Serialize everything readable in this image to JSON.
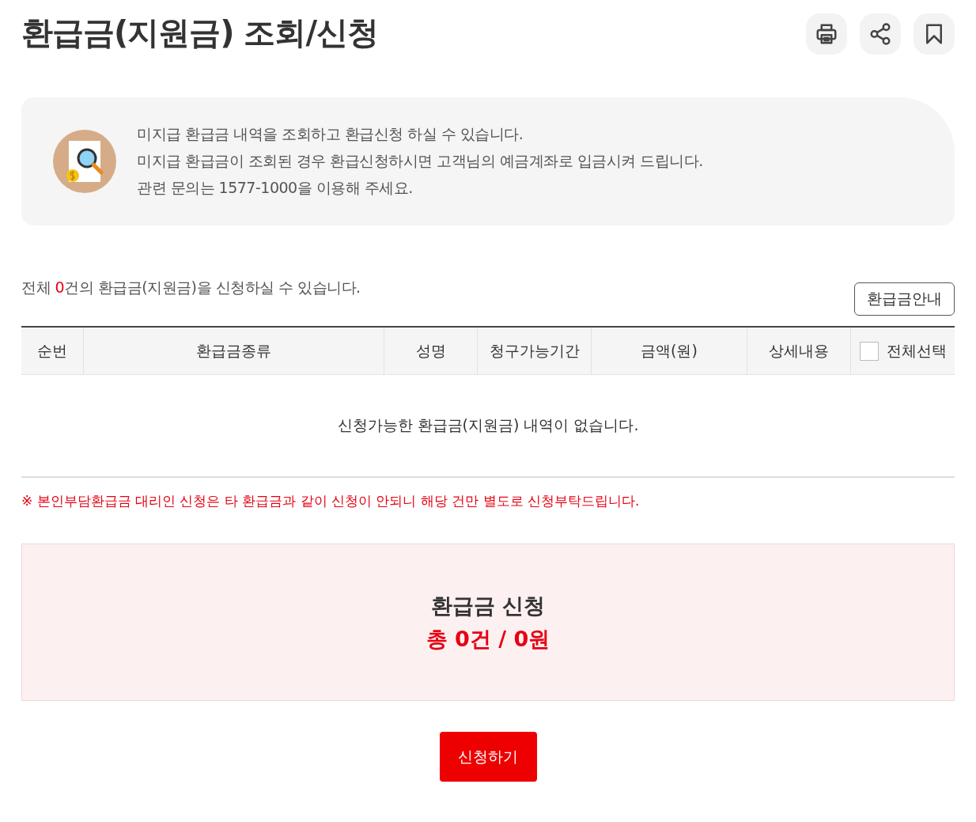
{
  "page": {
    "title": "환급금(지원금) 조회/신청"
  },
  "info": {
    "lines": [
      "미지급 환급금 내역을 조회하고 환급신청 하실 수 있습니다.",
      "미지급 환급금이 조회된 경우 환급신청하시면 고객님의 예금계좌로 입금시켜 드립니다.",
      "관련 문의는 1577-1000을 이용해 주세요."
    ]
  },
  "summary": {
    "prefix": "전체 ",
    "count": "0",
    "suffix": "건의 환급금(지원금)을 신청하실 수 있습니다.",
    "guide_button": "환급금안내"
  },
  "table": {
    "columns": [
      {
        "label": "순번",
        "kind": "text"
      },
      {
        "label": "환급금종류",
        "kind": "text"
      },
      {
        "label": "성명",
        "kind": "text"
      },
      {
        "label": "청구가능기간",
        "kind": "text"
      },
      {
        "label": "금액(원)",
        "kind": "text"
      },
      {
        "label": "상세내용",
        "kind": "text"
      },
      {
        "label": "전체선택",
        "kind": "checkbox",
        "checked": false
      }
    ],
    "empty_message": "신청가능한 환급금(지원금) 내역이 없습니다."
  },
  "notice": "※ 본인부담환급금 대리인 신청은 타 환급금과 같이 신청이 안되니 해당 건만 별도로 신청부탁드립니다.",
  "total": {
    "title": "환급금 신청",
    "amount": "총 0건 / 0원"
  },
  "submit_button": "신청하기"
}
